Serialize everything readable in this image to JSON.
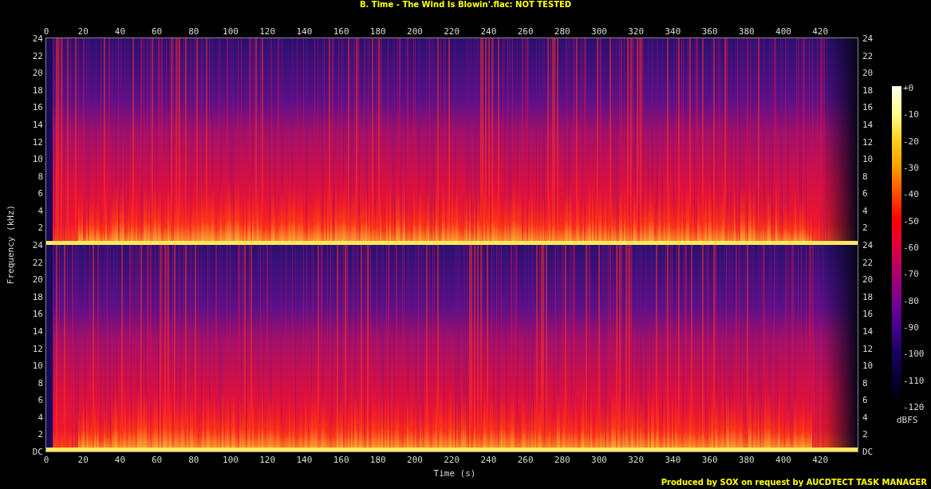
{
  "title": "B. Time - The Wind Is Blowin'.flac: NOT TESTED",
  "x_axis": {
    "label": "Time (s)",
    "top_ticks": [
      "0",
      "20",
      "40",
      "60",
      "80",
      "100",
      "120",
      "140",
      "160",
      "180",
      "200",
      "220",
      "240",
      "260",
      "280",
      "300",
      "320",
      "340",
      "360",
      "380",
      "400",
      "420"
    ],
    "bottom_ticks": [
      "0",
      "20",
      "40",
      "60",
      "80",
      "100",
      "120",
      "140",
      "160",
      "180",
      "200",
      "220",
      "240",
      "260",
      "280",
      "300",
      "320",
      "340",
      "360",
      "380",
      "400",
      "420"
    ]
  },
  "y_axis": {
    "label": "Frequency (kHz)"
  },
  "channels": [
    {
      "left_ticks": [
        "24",
        "22",
        "20",
        "18",
        "16",
        "14",
        "12",
        "10",
        "8",
        "6",
        "4",
        "2"
      ],
      "right_ticks": [
        "24",
        "22",
        "20",
        "18",
        "16",
        "14",
        "12",
        "10",
        "8",
        "6",
        "4",
        "2"
      ]
    },
    {
      "left_ticks": [
        "24",
        "22",
        "20",
        "18",
        "16",
        "14",
        "12",
        "10",
        "8",
        "6",
        "4",
        "2",
        "DC"
      ],
      "right_ticks": [
        "24",
        "22",
        "20",
        "18",
        "16",
        "14",
        "12",
        "10",
        "8",
        "6",
        "4",
        "2",
        "DC"
      ]
    }
  ],
  "colorbar": {
    "ticks": [
      "+0",
      "-10",
      "-20",
      "-30",
      "-40",
      "-50",
      "-60",
      "-70",
      "-80",
      "-90",
      "-100",
      "-110",
      "-120"
    ],
    "unit": "dBFS"
  },
  "footer": "Produced by SOX on request by AUCDTECT TASK MANAGER"
}
